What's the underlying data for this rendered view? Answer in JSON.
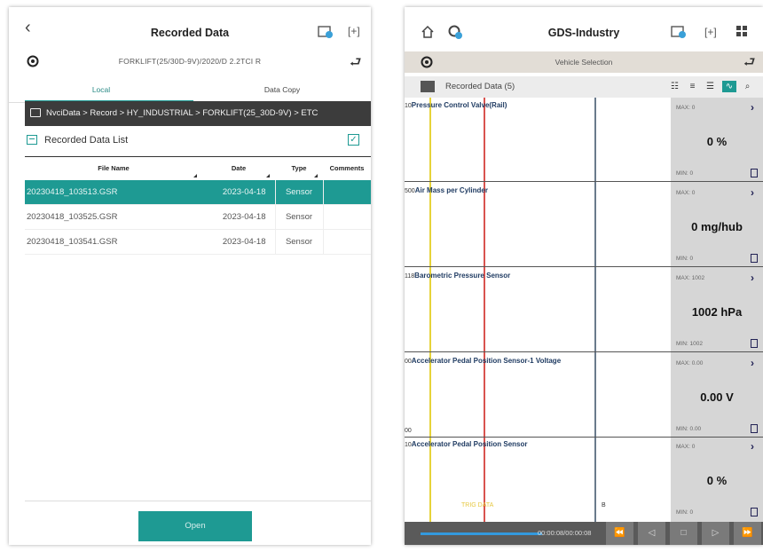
{
  "left": {
    "title": "Recorded Data",
    "vin": "FORKLIFT(25/30D-9V)/2020/D 2.2TCI R",
    "tabs": {
      "local": "Local",
      "data_copy": "Data Copy"
    },
    "path": "NvciData > Record > HY_INDUSTRIAL > FORKLIFT(25_30D-9V) > ETC",
    "list_label": "Recorded Data List",
    "columns": [
      "File Name",
      "Date",
      "Type",
      "Comments"
    ],
    "rows": [
      {
        "file": "20230418_103513.GSR",
        "date": "2023-04-18",
        "type": "Sensor",
        "comment": ""
      },
      {
        "file": "20230418_103525.GSR",
        "date": "2023-04-18",
        "type": "Sensor",
        "comment": ""
      },
      {
        "file": "20230418_103541.GSR",
        "date": "2023-04-18",
        "type": "Sensor",
        "comment": ""
      }
    ],
    "open_label": "Open",
    "accent": "#1e9a93"
  },
  "right": {
    "title": "GDS-Industry",
    "vehicle_selection": "Vehicle Selection",
    "recorded_label": "Recorded Data (5)",
    "sensors": [
      {
        "scale": "10",
        "name": "Pressure Control Valve(Rail)",
        "max": "MAX: 0",
        "value": "0 %",
        "min": "MIN: 0"
      },
      {
        "scale": "500",
        "name": "Air Mass per Cylinder",
        "max": "MAX: 0",
        "value": "0 mg/hub",
        "min": "MIN: 0"
      },
      {
        "scale": "118",
        "name": "Barometric Pressure Sensor",
        "max": "MAX: 1002",
        "value": "1002 hPa",
        "min": "MIN: 1002"
      },
      {
        "scale": "00",
        "name": "Accelerator Pedal Position Sensor-1 Voltage",
        "max": "MAX: 0.00",
        "value": "0.00 V",
        "min": "MIN: 0.00"
      },
      {
        "scale": "10",
        "name": "Accelerator Pedal Position Sensor",
        "max": "MAX: 0",
        "value": "0 %",
        "min": "MIN: 0"
      }
    ],
    "scale_bottom_00": "00",
    "trig_label": "TRIG DATA",
    "b_marker": "B",
    "time": "00:00:08/00:00:08",
    "progress": 0.38
  }
}
